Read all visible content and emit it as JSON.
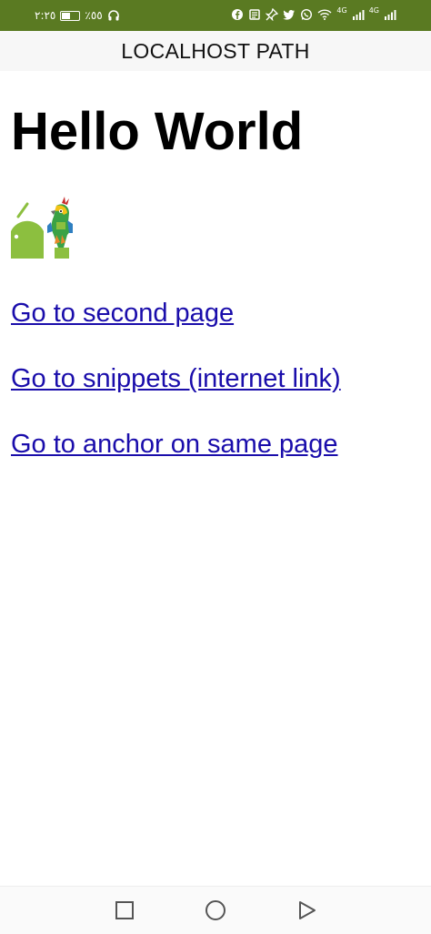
{
  "status_bar": {
    "time": "٢:٢٥",
    "battery_percent": "٪٥٥",
    "battery_level": 0.55,
    "network_1": "4G",
    "network_2": "4G",
    "background_color": "#5a7a22",
    "icons": [
      "headset-icon",
      "facebook-icon",
      "news-icon",
      "pin-icon",
      "twitter-icon",
      "whatsapp-icon",
      "wifi-icon",
      "signal-icon"
    ]
  },
  "app_bar": {
    "title": "LOCALHOST PATH"
  },
  "page": {
    "heading": "Hello World",
    "logo_icon": "android-parrot-logo-icon",
    "links": [
      {
        "label": "Go to second page"
      },
      {
        "label": "Go to snippets (internet link)"
      },
      {
        "label": "Go to anchor on same page"
      }
    ],
    "link_color": "#1a0dab"
  },
  "nav_bar": {
    "icons": [
      "recents-square-icon",
      "home-circle-icon",
      "back-triangle-icon"
    ]
  }
}
